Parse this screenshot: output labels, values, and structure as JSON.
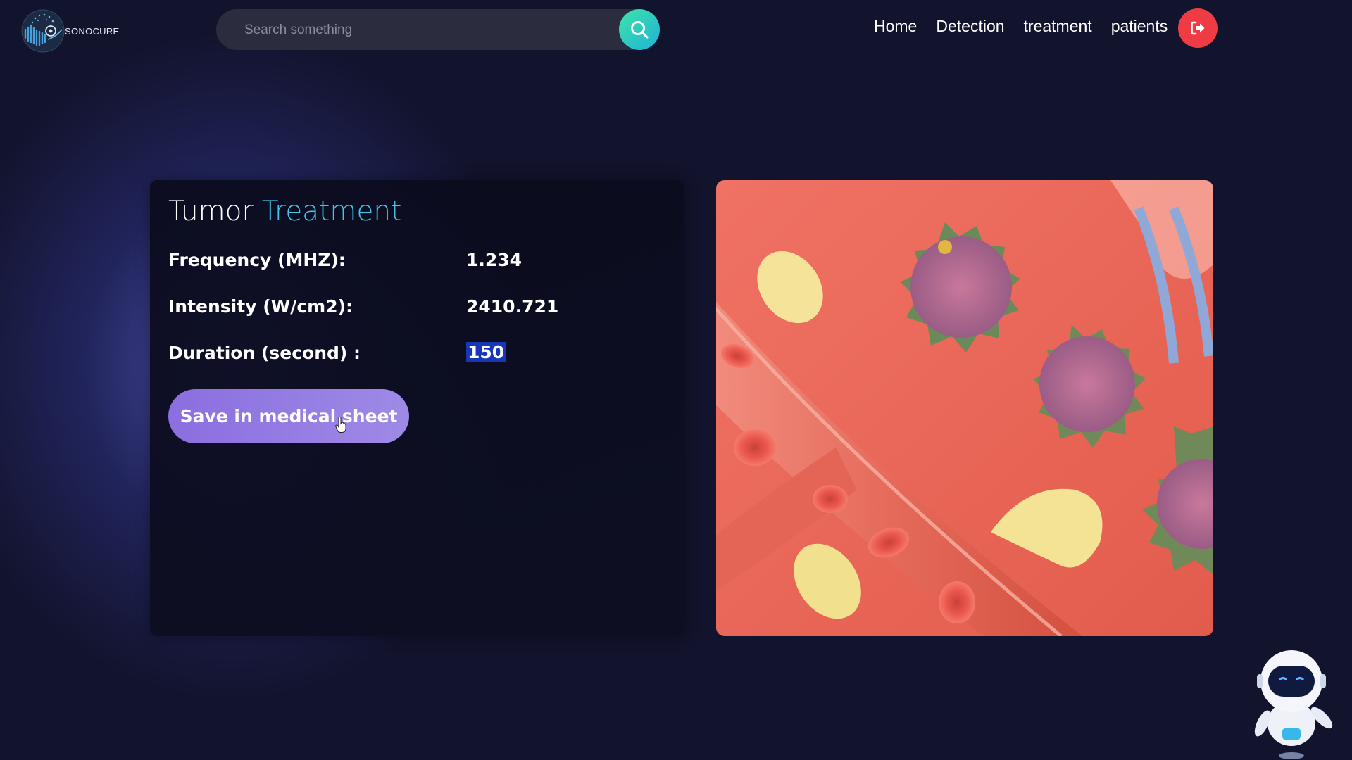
{
  "header": {
    "logo_text": "SONOCURE",
    "search": {
      "placeholder": "Search something",
      "value": ""
    },
    "nav": [
      {
        "label": "Home"
      },
      {
        "label": "Detection"
      },
      {
        "label": "treatment"
      },
      {
        "label": "patients"
      }
    ]
  },
  "treatment": {
    "title_word1": "Tumor",
    "title_word2": "Treatment",
    "rows": [
      {
        "label": "Frequency (MHZ):",
        "value": "1.234"
      },
      {
        "label": "Intensity (W/cm2):",
        "value": "2410.721"
      },
      {
        "label": "Duration (second) :",
        "value": "150"
      }
    ],
    "save_label": "Save in medical sheet"
  },
  "colors": {
    "background": "#12132c",
    "accent_title": "#3fc8ea",
    "button": "#8b6ee0",
    "logout": "#ef3b44",
    "search_button": "#1fb2d6"
  },
  "icons": [
    "logo-icon",
    "search-icon",
    "logout-icon",
    "robot-assistant-icon"
  ]
}
